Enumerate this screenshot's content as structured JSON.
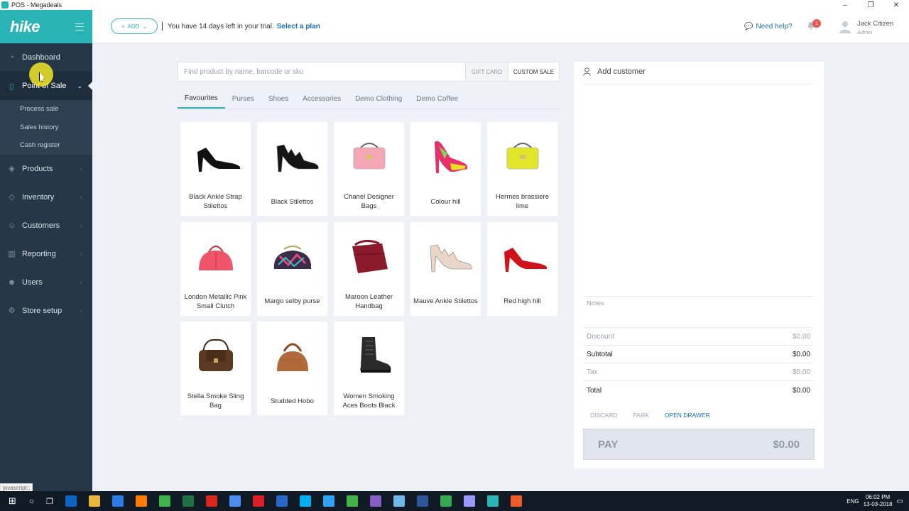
{
  "window": {
    "title": "POS - Megadeals",
    "controls": [
      "–",
      "❐",
      "✕"
    ]
  },
  "sidebar": {
    "logo": "hike",
    "items": [
      {
        "label": "Dashboard",
        "icon": "dashboard-icon",
        "active": false
      },
      {
        "label": "Point of Sale",
        "icon": "clipboard-icon",
        "active": true
      },
      {
        "label": "Products",
        "icon": "tag-icon",
        "active": false
      },
      {
        "label": "Inventory",
        "icon": "layers-icon",
        "active": false
      },
      {
        "label": "Customers",
        "icon": "users-icon",
        "active": false
      },
      {
        "label": "Reporting",
        "icon": "bar-chart-icon",
        "active": false
      },
      {
        "label": "Users",
        "icon": "user-icon",
        "active": false
      },
      {
        "label": "Store setup",
        "icon": "gear-icon",
        "active": false
      }
    ],
    "sub_items": [
      "Process sale",
      "Sales history",
      "Cash register"
    ]
  },
  "topbar": {
    "add_label": "ADD",
    "trial_text": "You have 14 days left in your trial.",
    "trial_link": "Select a plan",
    "help_label": "Need help?",
    "notification_count": "1",
    "user_name": "Jack Citizen",
    "user_role": "Admin"
  },
  "search": {
    "placeholder": "Find product by name, barcode or sku",
    "gift_card_label": "GIFT CARD",
    "custom_sale_label": "CUSTOM SALE"
  },
  "tabs": [
    "Favourites",
    "Purses",
    "Shoes",
    "Accessories",
    "Demo Clothing",
    "Demo Coffee"
  ],
  "active_tab": "Favourites",
  "products": [
    {
      "name": "Black Ankle Strap Stilettos",
      "kind": "heel",
      "color": "#111111"
    },
    {
      "name": "Black Stilettos",
      "kind": "strappy-heel",
      "color": "#151515"
    },
    {
      "name": "Chanel Designer Bags",
      "kind": "bag",
      "color": "#f4a7b4"
    },
    {
      "name": "Colour hill",
      "kind": "platform",
      "color": "#e8306a"
    },
    {
      "name": "Hermes brassiere lime",
      "kind": "bag",
      "color": "#e2e62a"
    },
    {
      "name": "London Metallic Pink Small Clutch",
      "kind": "dome-bag",
      "color": "#f0546a"
    },
    {
      "name": "Margo selby purse",
      "kind": "purse",
      "color": "#3b2d4a"
    },
    {
      "name": "Maroon Leather Handbag",
      "kind": "sling",
      "color": "#8b1a2b"
    },
    {
      "name": "Mauve Ankle Stilettos",
      "kind": "strappy-heel",
      "color": "#e9d6c8"
    },
    {
      "name": "Red high hill",
      "kind": "heel",
      "color": "#d0121b"
    },
    {
      "name": "Stella Smoke Sling Bag",
      "kind": "satchel",
      "color": "#5a3a22"
    },
    {
      "name": "Studded Hobo",
      "kind": "hobo",
      "color": "#b0693a"
    },
    {
      "name": "Women Smoking Aces Boots Black",
      "kind": "boot",
      "color": "#2a2a2a"
    }
  ],
  "cart": {
    "add_customer_label": "Add customer",
    "notes_label": "Notes",
    "discount_label": "Discount",
    "discount_value": "$0.00",
    "subtotal_label": "Subtotal",
    "subtotal_value": "$0.00",
    "tax_label": "Tax",
    "tax_value": "$0.00",
    "total_label": "Total",
    "total_value": "$0.00",
    "discard_label": "DISCARD",
    "park_label": "PARK",
    "open_drawer_label": "OPEN DRAWER",
    "pay_label": "PAY",
    "pay_value": "$0.00"
  },
  "status_text": "javascript:;",
  "taskbar": {
    "language": "ENG",
    "time": "06:02 PM",
    "date": "13-03-2018",
    "apps": [
      {
        "name": "outlook-icon",
        "color": "#0b64c0"
      },
      {
        "name": "folder-icon",
        "color": "#e8b63a"
      },
      {
        "name": "store-icon",
        "color": "#2c7be5"
      },
      {
        "name": "illustrator-icon",
        "color": "#ff7c00"
      },
      {
        "name": "dreamweaver-icon",
        "color": "#3bb54a"
      },
      {
        "name": "excel-icon",
        "color": "#1e7145"
      },
      {
        "name": "acrobat-icon",
        "color": "#d8251d"
      },
      {
        "name": "chrome-icon",
        "color": "#4a8cf0"
      },
      {
        "name": "creative-cloud-icon",
        "color": "#da1f26"
      },
      {
        "name": "firefox-icon",
        "color": "#2867c7"
      },
      {
        "name": "skype-icon",
        "color": "#00aff0"
      },
      {
        "name": "photoshop-icon",
        "color": "#2fa3f7"
      },
      {
        "name": "camtasia-icon",
        "color": "#3fb54a"
      },
      {
        "name": "visual-studio-icon",
        "color": "#865fc5"
      },
      {
        "name": "browser-icon",
        "color": "#6fb8e8"
      },
      {
        "name": "word-icon",
        "color": "#2b579a"
      },
      {
        "name": "chrome-alt-icon",
        "color": "#34a853"
      },
      {
        "name": "after-effects-icon",
        "color": "#9999ff"
      },
      {
        "name": "hike-app-icon",
        "color": "#2bb4b6"
      },
      {
        "name": "orange-app-icon",
        "color": "#f05a28"
      }
    ]
  }
}
